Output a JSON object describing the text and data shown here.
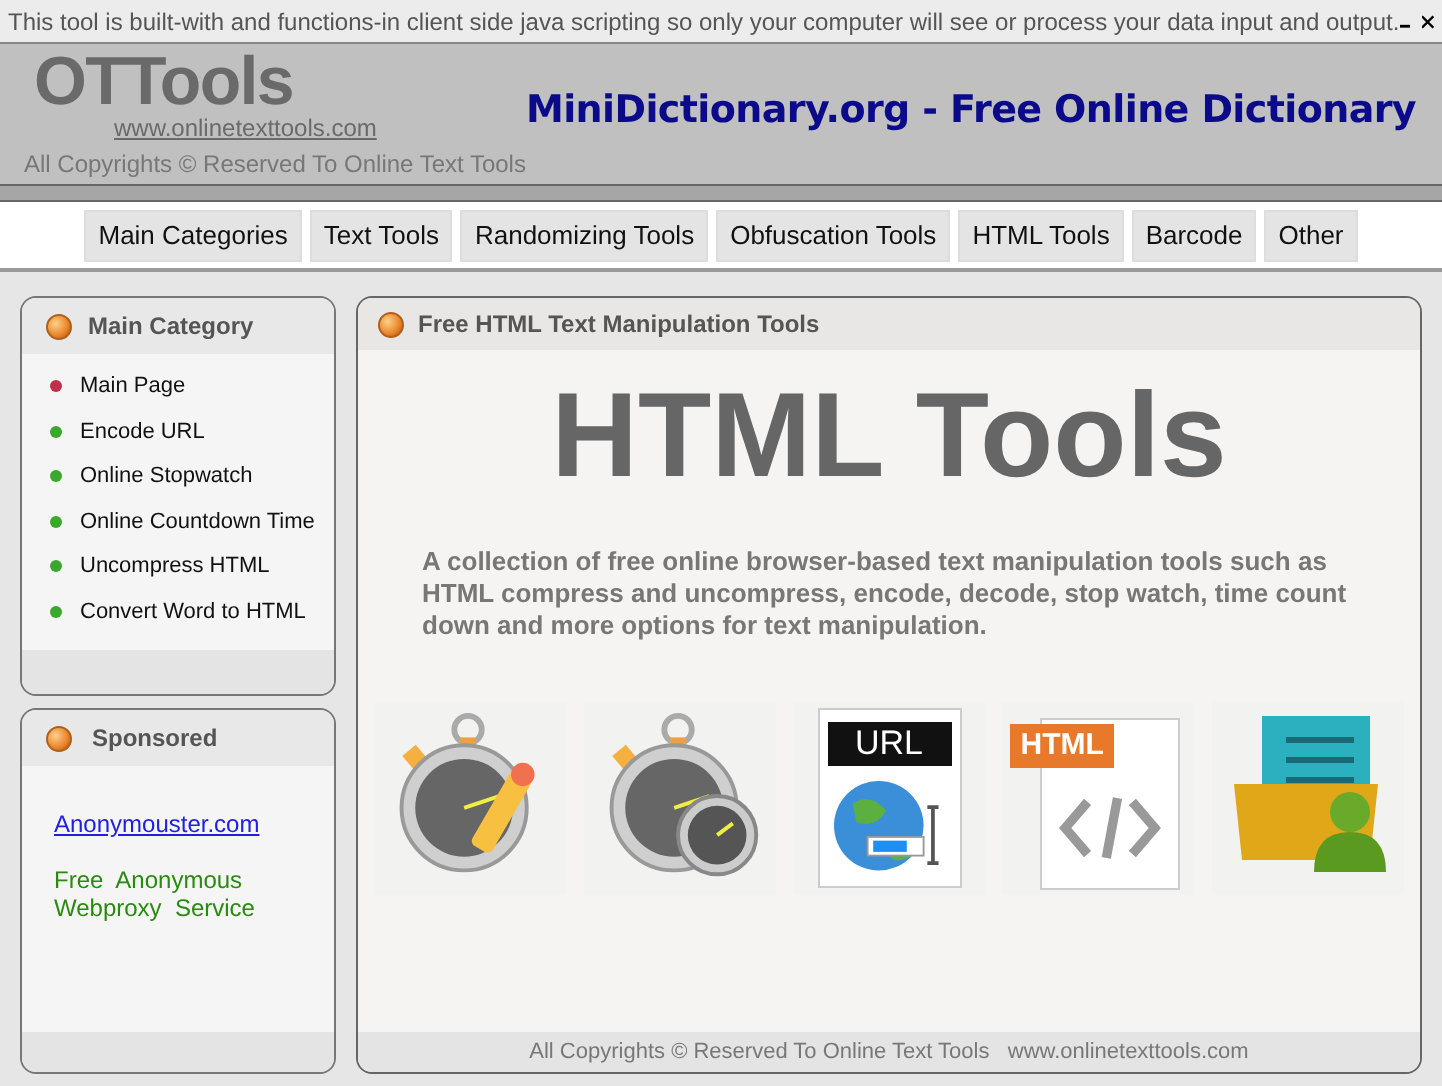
{
  "notice_bar": {
    "text": "This tool is built-with and functions-in client side java scripting so only your computer will see or process your data input and output."
  },
  "header": {
    "logo": "OTTools",
    "logo_url": "www.onlinetexttools.com",
    "copyright": "All Copyrights © Reserved To Online Text Tools",
    "banner": "MiniDictionary.org - Free Online Dictionary"
  },
  "nav": [
    {
      "label": "Main Categories",
      "selected": false
    },
    {
      "label": "Text Tools",
      "selected": false
    },
    {
      "label": "Randomizing Tools",
      "selected": false
    },
    {
      "label": "Obfuscation Tools",
      "selected": false
    },
    {
      "label": "HTML Tools",
      "selected": false
    },
    {
      "label": "Barcode",
      "selected": false
    },
    {
      "label": "Other",
      "selected": false
    }
  ],
  "sidebar": {
    "title": "Main Category",
    "items": [
      {
        "label": "Main Page",
        "selected": true
      },
      {
        "label": "Encode URL",
        "selected": false
      },
      {
        "label": "Online Stopwatch",
        "selected": false
      },
      {
        "label": "Online Countdown Time",
        "selected": false
      },
      {
        "label": "Uncompress HTML",
        "selected": false
      },
      {
        "label": "Convert Word to HTML",
        "selected": false
      }
    ]
  },
  "sponsored": {
    "title": "Sponsored",
    "link": "Anonymouster.com",
    "text": "Free  Anonymous Webproxy  Service"
  },
  "main": {
    "title": "Free HTML Text Manipulation Tools",
    "heading": "HTML Tools",
    "description": "A collection of free online browser-based text manipulation tools such as HTML compress and uncompress, encode, decode, stop watch, time count down and more options for text manipulation.",
    "tools": [
      {
        "kind": "stopwatch_pencil"
      },
      {
        "kind": "stopwatch_clock"
      },
      {
        "kind": "url",
        "label": "URL"
      },
      {
        "kind": "html",
        "label": "HTML"
      },
      {
        "kind": "folder_user"
      }
    ],
    "footer": "All Copyrights © Reserved To Online Text Tools   www.onlinetexttools.com"
  }
}
